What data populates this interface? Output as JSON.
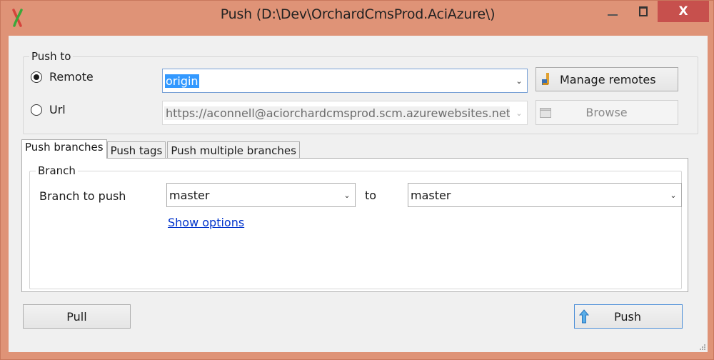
{
  "window": {
    "title": "Push (D:\\Dev\\OrchardCmsProd.AciAzure\\)",
    "close_glyph": "X"
  },
  "push_to": {
    "legend": "Push to",
    "remote_radio_label": "Remote",
    "remote_selected": true,
    "url_radio_label": "Url",
    "url_selected": false,
    "remote_value": "origin",
    "url_value": "https://aconnell@aciorchardcmsprod.scm.azurewebsites.net",
    "manage_remotes_label": "Manage remotes",
    "browse_label": "Browse"
  },
  "tabs": [
    {
      "label": "Push branches",
      "active": true
    },
    {
      "label": "Push tags",
      "active": false
    },
    {
      "label": "Push multiple branches",
      "active": false
    }
  ],
  "branch": {
    "legend": "Branch",
    "branch_to_push_label": "Branch to push",
    "local_branch": "master",
    "to_label": "to",
    "remote_branch": "master",
    "show_options_label": "Show options"
  },
  "buttons": {
    "pull_label": "Pull",
    "push_label": "Push"
  },
  "colors": {
    "titlebar": "#df9377",
    "close_button": "#c7504d",
    "selection": "#3399ff",
    "link": "#0033cc"
  }
}
